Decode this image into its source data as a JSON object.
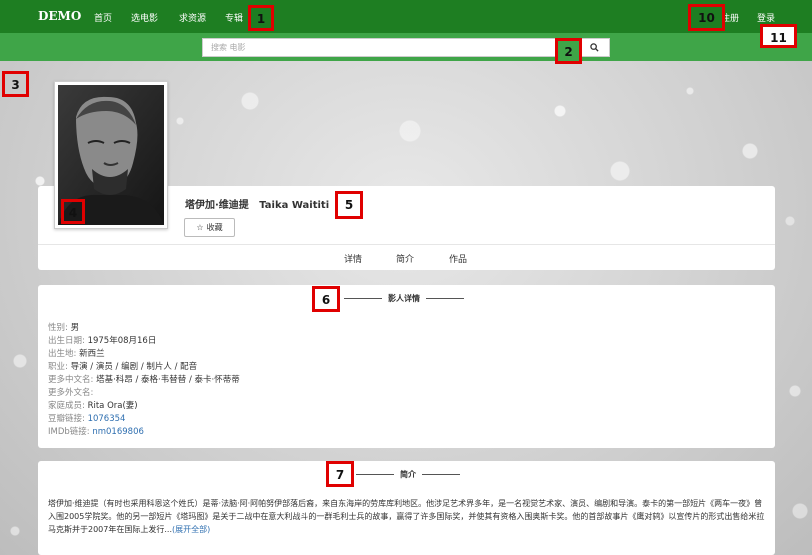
{
  "header": {
    "logo": "DEMO",
    "nav": [
      "首页",
      "选电影",
      "求资源",
      "专辑"
    ],
    "register": "注册",
    "login": "登录"
  },
  "search": {
    "placeholder": "搜索 电影"
  },
  "person": {
    "name_cn": "塔伊加·维迪提",
    "name_en": "Taika Waititi",
    "favorite_label": "收藏",
    "tabs": [
      "详情",
      "简介",
      "作品"
    ]
  },
  "details": {
    "title": "影人详情",
    "rows": [
      {
        "label": "性别: ",
        "value": "男"
      },
      {
        "label": "出生日期: ",
        "value": "1975年08月16日"
      },
      {
        "label": "出生地: ",
        "value": "新西兰"
      },
      {
        "label": "职业: ",
        "value": "导演 / 演员 / 编剧 / 制片人 / 配音"
      },
      {
        "label": "更多中文名: ",
        "value": "塔基·科昂 / 泰格·韦替替 / 泰卡·怀蒂蒂"
      },
      {
        "label": "更多外文名: ",
        "value": ""
      },
      {
        "label": "家庭成员: ",
        "value": "Rita Ora(妻)"
      },
      {
        "label": "豆瓣链接: ",
        "value": "1076354"
      },
      {
        "label": "IMDb链接: ",
        "value": "nm0169806"
      }
    ]
  },
  "intro": {
    "title": "简介",
    "text": "塔伊加·维迪提（有时也采用科恩这个姓氏）是蒂·法脑·阿·阿帕努伊部落后裔，来自东海岸的劳库库利地区。他涉足艺术界多年，是一名视觉艺术家、演员、编剧和导演。泰卡的第一部短片《两车一夜》曾入围2005学院奖。他的另一部短片《塔玛图》是关于二战中在意大利战斗的一群毛利士兵的故事，赢得了许多国际奖，并使其有资格入围奥斯卡奖。他的首部故事片《鹰对鸫》以宣传片的形式出售给米拉马克斯并于2007年在国际上发行...",
    "more": "(展开全部)"
  },
  "annotations": [
    "1",
    "2",
    "3",
    "4",
    "5",
    "6",
    "7",
    "10",
    "11"
  ],
  "colors": {
    "header_bg": "#1e7e22",
    "search_bg": "#3fa548",
    "link": "#2f6fb0",
    "tag_border": "#e00000"
  }
}
